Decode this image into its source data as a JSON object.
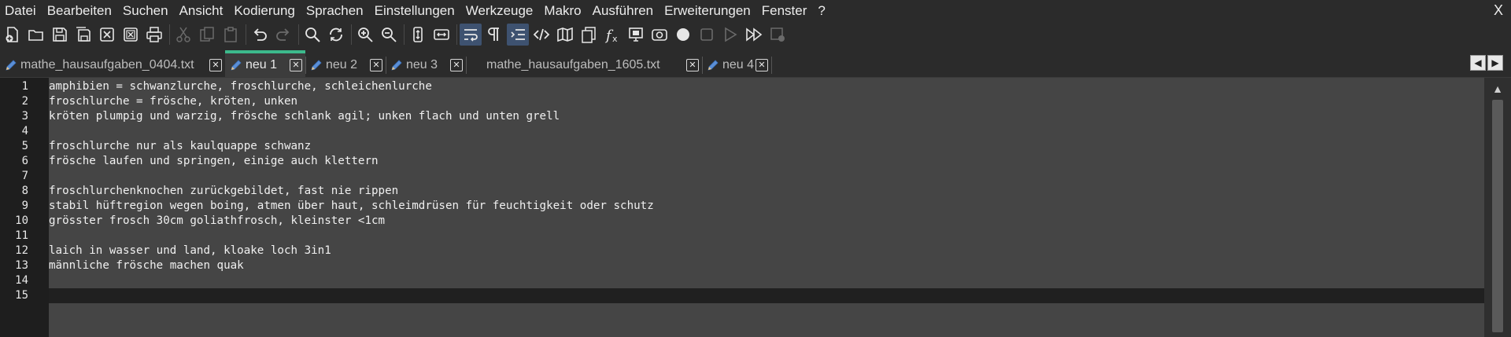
{
  "menu": [
    "Datei",
    "Bearbeiten",
    "Suchen",
    "Ansicht",
    "Kodierung",
    "Sprachen",
    "Einstellungen",
    "Werkzeuge",
    "Makro",
    "Ausführen",
    "Erweiterungen",
    "Fenster",
    "?"
  ],
  "window_close": "X",
  "toolbar": {
    "buttons": [
      "new-file-icon",
      "open-file-icon",
      "save-icon",
      "save-all-icon",
      "close-icon",
      "close-all-icon",
      "print-icon",
      "cut-icon",
      "copy-icon",
      "paste-icon",
      "undo-icon",
      "redo-icon",
      "find-icon",
      "replace-icon",
      "zoom-in-icon",
      "zoom-out-icon",
      "sync-vertical-icon",
      "sync-horizontal-icon",
      "word-wrap-icon",
      "show-all-characters-icon",
      "indent-guide-icon",
      "xml-tags-icon",
      "document-map-icon",
      "document-list-icon",
      "function-list-icon",
      "monitoring-icon",
      "eye-icon",
      "record-macro-icon",
      "stop-recording-icon",
      "play-macro-icon",
      "run-macro-multiple-icon",
      "save-macro-icon"
    ]
  },
  "tabs": [
    {
      "label": "mathe_hausaufgaben_0404.txt",
      "icon": "pencil-icon",
      "active": false
    },
    {
      "label": "neu 1",
      "icon": "pencil-icon",
      "active": true
    },
    {
      "label": "neu 2",
      "icon": "pencil-icon",
      "active": false
    },
    {
      "label": "neu 3",
      "icon": "pencil-icon",
      "active": false
    },
    {
      "label": "mathe_hausaufgaben_1605.txt",
      "icon": "none",
      "active": false
    },
    {
      "label": "neu 4",
      "icon": "pencil-icon",
      "active": false
    }
  ],
  "tab_nav": {
    "left": "◀",
    "right": "▶"
  },
  "editor": {
    "line_numbers": [
      "1",
      "2",
      "3",
      "4",
      "5",
      "6",
      "7",
      "8",
      "9",
      "10",
      "11",
      "12",
      "13",
      "14",
      "15"
    ],
    "lines": [
      "amphibien = schwanzlurche, froschlurche, schleichenlurche",
      "froschlurche = frösche, kröten, unken",
      "kröten plumpig und warzig, frösche schlank agil; unken flach und unten grell",
      "",
      "froschlurche nur als kaulquappe schwanz",
      "frösche laufen und springen, einige auch klettern",
      "",
      "froschlurchenknochen zurückgebildet, fast nie rippen",
      "stabil hüftregion wegen boing, atmen über haut, schleimdrüsen für feuchtigkeit oder schutz",
      "grösster frosch 30cm goliathfrosch, kleinster <1cm",
      "",
      "laich in wasser und land, kloake loch 3in1",
      "männliche frösche machen quak",
      "",
      ""
    ],
    "current_line": 15,
    "scroll_up": "▲"
  },
  "colors": {
    "active_tab_accent": "#3cba8c",
    "toolbar_active_bg": "#3e5270"
  }
}
